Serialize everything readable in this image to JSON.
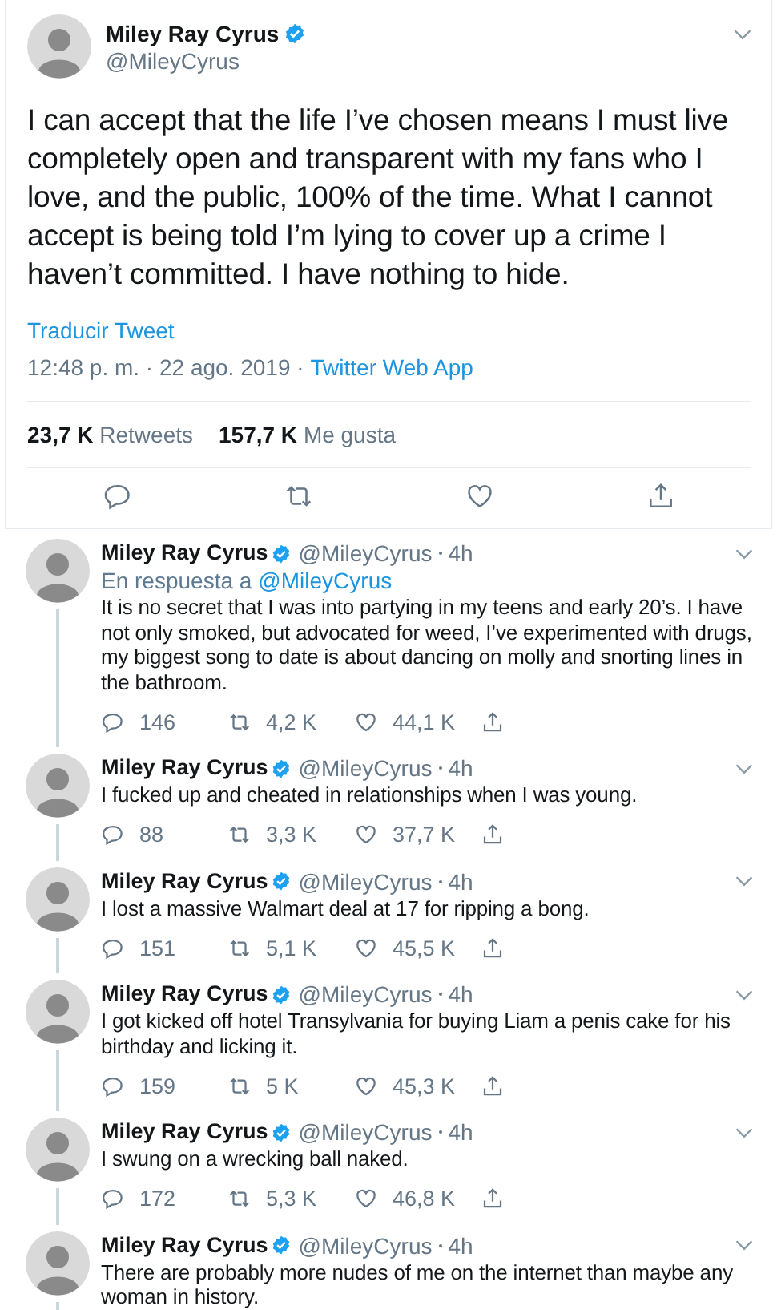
{
  "main_tweet": {
    "name": "Miley Ray Cyrus",
    "verified": true,
    "handle": "@MileyCyrus",
    "text": "I can accept that the life I’ve chosen means I must live completely open and transparent with my fans who I love, and the public, 100% of the time. What I cannot accept is being told I’m lying to cover up a crime I haven’t committed. I have nothing to hide.",
    "translate_link": "Traducir Tweet",
    "timestamp": "12:48 p. m. · 22 ago. 2019 ·",
    "source": "Twitter Web App",
    "stats": [
      {
        "count": "23,7 K",
        "label": "Retweets"
      },
      {
        "count": "157,7 K",
        "label": "Me gusta"
      }
    ]
  },
  "replies": [
    {
      "name": "Miley Ray Cyrus",
      "verified": true,
      "handle": "@MileyCyrus",
      "time": "4h",
      "reply_prefix": "En respuesta a",
      "reply_to": "@MileyCyrus",
      "text": "It is no secret that I was into partying in my teens and early 20’s. I have not only smoked, but advocated for weed, I’ve experimented with drugs, my biggest song to date is about dancing on molly and snorting lines in the bathroom.",
      "replies": "146",
      "retweets": "4,2 K",
      "likes": "44,1 K"
    },
    {
      "name": "Miley Ray Cyrus",
      "verified": true,
      "handle": "@MileyCyrus",
      "time": "4h",
      "text": "I fucked up and cheated in relationships when I was young.",
      "replies": "88",
      "retweets": "3,3 K",
      "likes": "37,7 K"
    },
    {
      "name": "Miley Ray Cyrus",
      "verified": true,
      "handle": "@MileyCyrus",
      "time": "4h",
      "text": "I lost a massive Walmart deal at 17 for ripping a bong.",
      "replies": "151",
      "retweets": "5,1 K",
      "likes": "45,5 K"
    },
    {
      "name": "Miley Ray Cyrus",
      "verified": true,
      "handle": "@MileyCyrus",
      "time": "4h",
      "text": "I got kicked off hotel Transylvania for buying Liam a penis cake for his birthday and licking it.",
      "replies": "159",
      "retweets": "5 K",
      "likes": "45,3 K"
    },
    {
      "name": "Miley Ray Cyrus",
      "verified": true,
      "handle": "@MileyCyrus",
      "time": "4h",
      "text": "I swung on a wrecking ball naked.",
      "replies": "172",
      "retweets": "5,3 K",
      "likes": "46,8 K"
    },
    {
      "name": "Miley Ray Cyrus",
      "verified": true,
      "handle": "@MileyCyrus",
      "time": "4h",
      "text": "There are probably more nudes of me on the internet than maybe any woman in history."
    }
  ]
}
